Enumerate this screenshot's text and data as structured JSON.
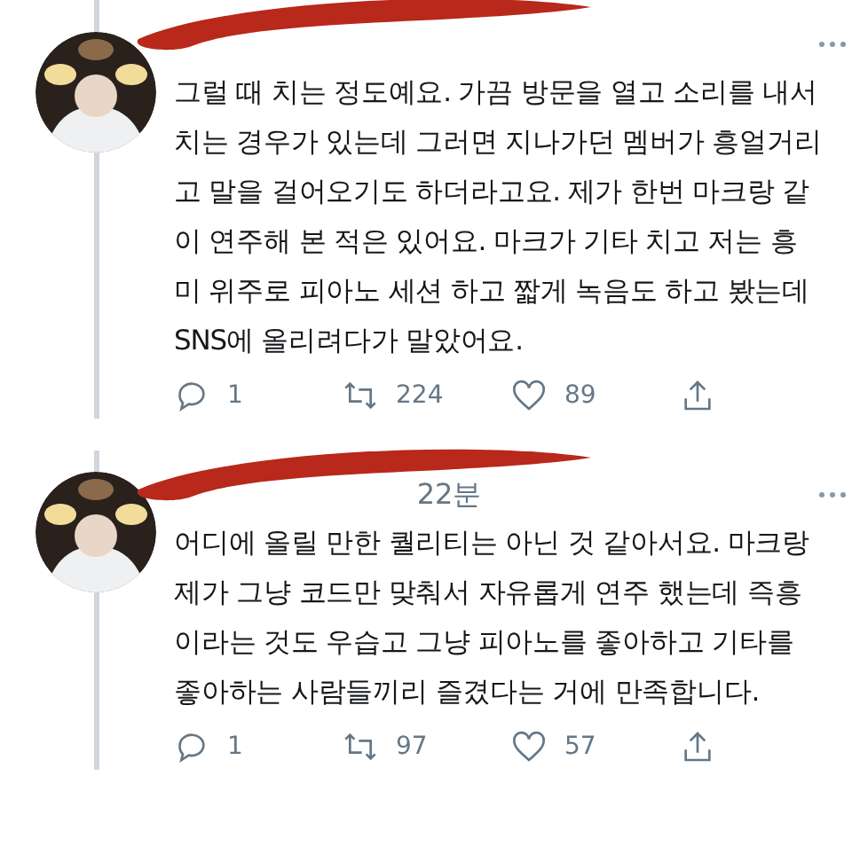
{
  "tweets": [
    {
      "text": "그럴 때 치는 정도예요. 가끔 방문을 열고 소리를 내서 치는 경우가 있는데 그러면 지나가던 멤버가 흥얼거리고 말을 걸어오기도 하더라고요. 제가 한번 마크랑 같이 연주해 본 적은 있어요. 마크가 기타 치고 저는 흥미 위주로 피아노 세션 하고 짧게 녹음도 하고 봤는데 SNS에 올리려다가 말았어요.",
      "replies": "1",
      "retweets": "224",
      "likes": "89"
    },
    {
      "time": "22분",
      "text": "어디에 올릴 만한 퀄리티는 아닌 것 같아서요. 마크랑 제가 그냥 코드만 맞춰서 자유롭게 연주 했는데 즉흥이라는 것도 우습고 그냥 피아노를 좋아하고 기타를 좋아하는 사람들끼리 즐겼다는 거에 만족합니다.",
      "replies": "1",
      "retweets": "97",
      "likes": "57"
    }
  ]
}
